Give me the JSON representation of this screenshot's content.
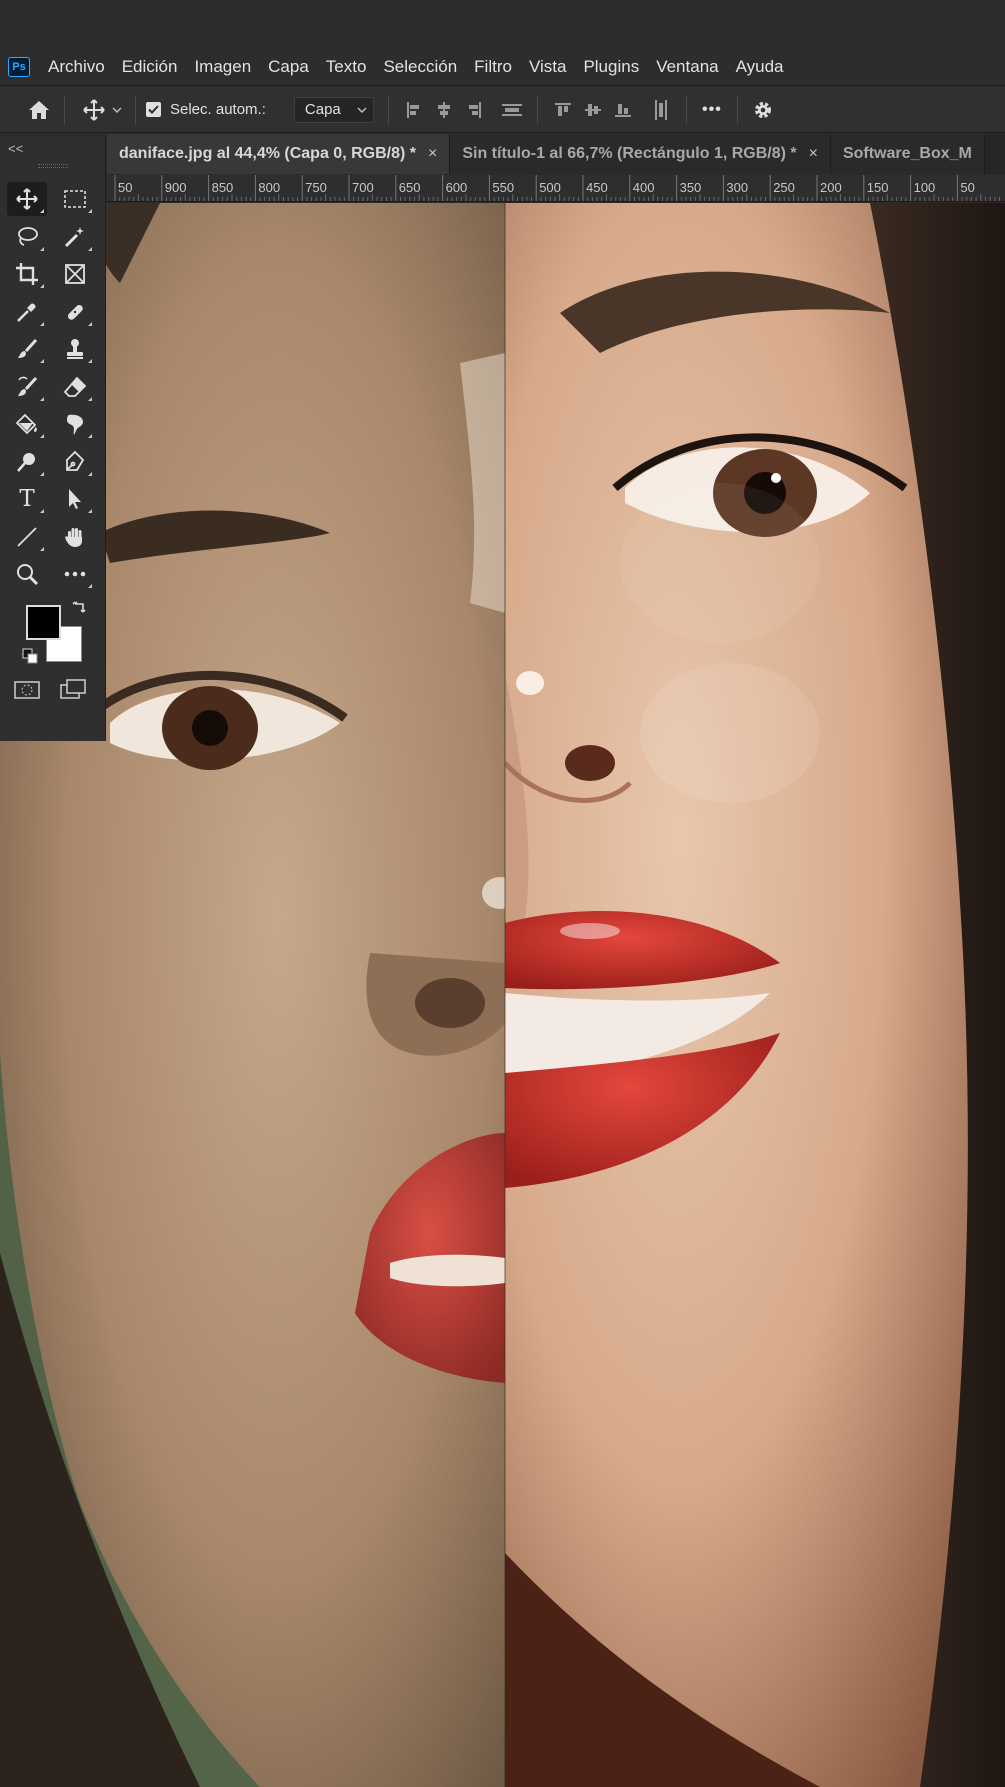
{
  "app": {
    "logo_text": "Ps"
  },
  "menu": [
    "Archivo",
    "Edición",
    "Imagen",
    "Capa",
    "Texto",
    "Selección",
    "Filtro",
    "Vista",
    "Plugins",
    "Ventana",
    "Ayuda"
  ],
  "options": {
    "auto_select_label": "Selec. autom.:",
    "auto_select_checked": true,
    "layer_dropdown_value": "Capa",
    "more_label": "•••"
  },
  "tabs": [
    {
      "label": "daniface.jpg al 44,4% (Capa 0, RGB/8) *",
      "close": "×",
      "active": true
    },
    {
      "label": "Sin título-1 al 66,7% (Rectángulo 1, RGB/8) *",
      "close": "×",
      "active": false
    },
    {
      "label": "Software_Box_M",
      "close": "",
      "active": false
    }
  ],
  "ruler": {
    "labels": [
      "50",
      "900",
      "850",
      "800",
      "750",
      "700",
      "650",
      "600",
      "550",
      "500",
      "450",
      "400",
      "350",
      "300",
      "250",
      "200",
      "150",
      "100",
      "50"
    ]
  },
  "toolbar": {
    "collapse_label": "<<",
    "tools": [
      "move-tool",
      "marquee-tool",
      "lasso-tool",
      "magic-wand-tool",
      "crop-tool",
      "frame-tool",
      "eyedropper-tool",
      "healing-brush-tool",
      "brush-tool",
      "clone-stamp-tool",
      "history-brush-tool",
      "eraser-tool",
      "paint-bucket-tool",
      "smudge-tool",
      "dodge-tool",
      "pen-tool",
      "type-tool",
      "path-selection-tool",
      "line-tool",
      "hand-tool",
      "zoom-tool",
      "more-tools"
    ],
    "type_tool_glyph": "T",
    "foreground_color": "#000000",
    "background_color": "#ffffff"
  },
  "colors": {
    "accent": "#31a8ff",
    "chrome": "#2d2d2d",
    "panel": "#2f2f2f"
  }
}
